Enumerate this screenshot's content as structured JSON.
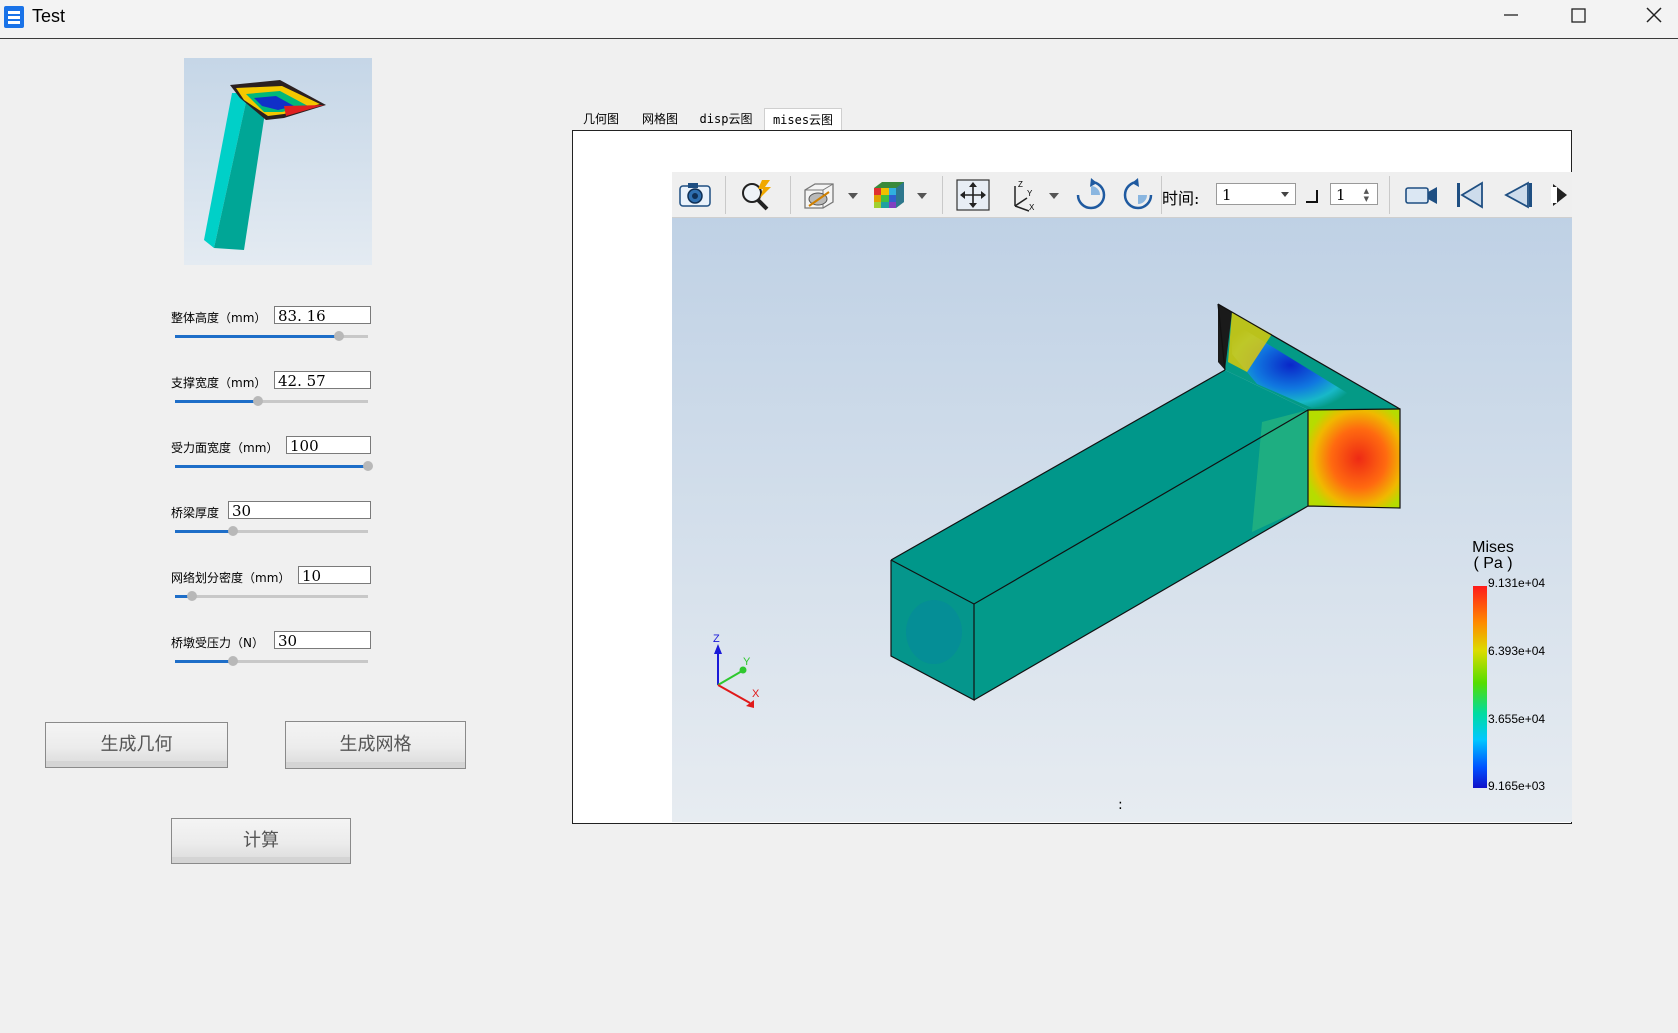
{
  "window": {
    "title": "Test"
  },
  "params": [
    {
      "label": "整体高度（mm）",
      "value": "83. 16",
      "level": 0.85
    },
    {
      "label": "支撑宽度（mm）",
      "value": "42. 57",
      "level": 0.43
    },
    {
      "label": "受力面宽度（mm）",
      "value": "100",
      "level": 1.0
    },
    {
      "label": "桥梁厚度",
      "value": "30",
      "level": 0.3
    },
    {
      "label": "网络划分密度（mm）",
      "value": "10",
      "level": 0.09
    },
    {
      "label": "桥墩受压力（N）",
      "value": "30",
      "level": 0.3
    }
  ],
  "buttons": {
    "generate_geometry": "生成几何",
    "generate_mesh": "生成网格",
    "compute": "计算"
  },
  "tabs": [
    "几何图",
    "网格图",
    "disp云图",
    "mises云图"
  ],
  "active_tab": "mises云图",
  "toolbar": {
    "icons": [
      "camera-icon",
      "zoom-icon",
      "display-mode-icon",
      "color-cube-icon",
      "pan-icon",
      "axes-icon",
      "rotate-cw-icon",
      "rotate-ccw-icon",
      "record-icon",
      "first-frame-icon",
      "prev-frame-icon",
      "next-frame-icon"
    ],
    "time_label": "时间:",
    "time_value": "1",
    "step_value": "1"
  },
  "legend": {
    "title_line1": "Mises",
    "title_line2": "( Pa )",
    "ticks": [
      "9.131e+04",
      "6.393e+04",
      "3.655e+04",
      "9.165e+03"
    ],
    "colors": [
      "#1010c8",
      "#00c8ff",
      "#00dca0",
      "#55dd00",
      "#dcdc00",
      "#ff8a00",
      "#ff1a1a"
    ]
  },
  "axes": {
    "x": "X",
    "y": "Y",
    "z": "Z"
  },
  "status_text": ":"
}
